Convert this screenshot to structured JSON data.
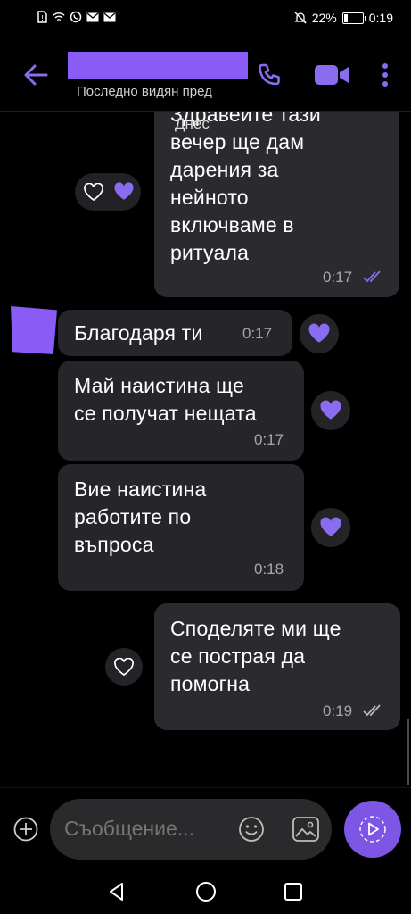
{
  "status_bar": {
    "battery_percent": "22%",
    "battery_level": 0.22,
    "time": "0:19"
  },
  "header": {
    "contact_name": "",
    "last_seen": "Последно видян пред"
  },
  "chat": {
    "date_separator": "Днес",
    "messages": [
      {
        "lines": [
          "Здравейте тази",
          "вечер ще дам",
          "дарения за",
          "нейното",
          "включваме в",
          "ритуала"
        ],
        "time": "0:17",
        "direction": "outgoing",
        "status": "read"
      },
      {
        "lines": [
          "Благодаря ти"
        ],
        "time": "0:17",
        "direction": "incoming"
      },
      {
        "lines": [
          "Май наистина ще",
          "се получат нещата"
        ],
        "time": "0:17",
        "direction": "incoming"
      },
      {
        "lines": [
          "Вие наистина",
          "работите по",
          "въпроса"
        ],
        "time": "0:18",
        "direction": "incoming"
      },
      {
        "lines": [
          "Споделяте ми ще",
          "се пострая да",
          "помогна"
        ],
        "time": "0:19",
        "direction": "outgoing",
        "status": "delivered"
      }
    ]
  },
  "composer": {
    "placeholder": "Съобщение..."
  },
  "colors": {
    "accent": "#7d56e6",
    "heart": "#8a6cf0",
    "bubble": "#2b2b2f",
    "background": "#000000"
  },
  "icons": {
    "back": "arrow-left-icon",
    "call": "phone-icon",
    "video": "video-camera-icon",
    "more": "more-vertical-icon",
    "like": "heart-icon",
    "add": "plus-circle-icon",
    "emoji": "smiley-icon",
    "gallery": "gallery-icon",
    "send": "send-icon"
  }
}
